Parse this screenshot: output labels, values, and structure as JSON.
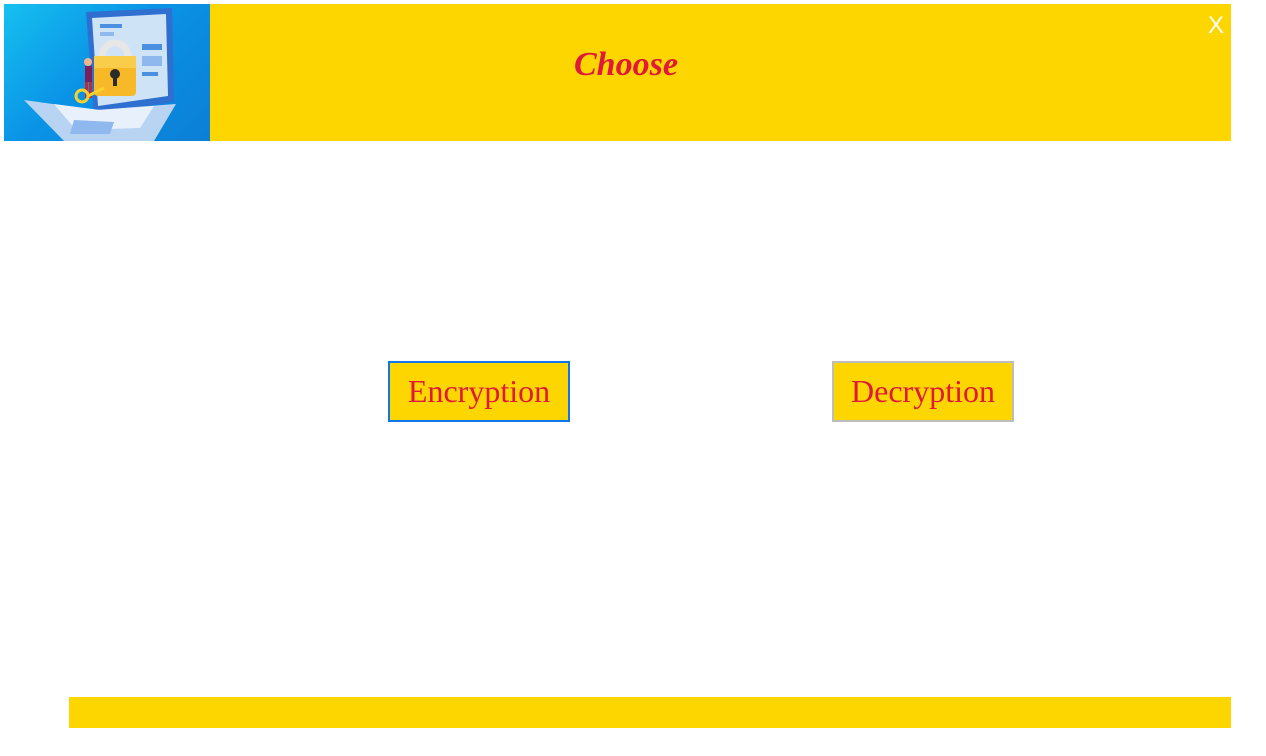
{
  "header": {
    "title": "Choose",
    "close_label": "X",
    "image_icon": "laptop-padlock-illustration"
  },
  "main": {
    "encryption_label": "Encryption",
    "decryption_label": "Decryption"
  },
  "colors": {
    "accent_yellow": "#FDD600",
    "text_red": "#E0193A",
    "focus_blue": "#1177E8"
  }
}
